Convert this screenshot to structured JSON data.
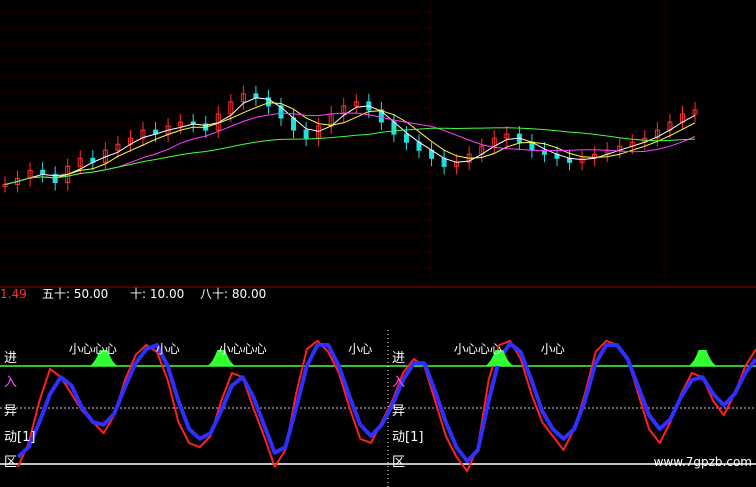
{
  "chart_data": [
    {
      "type": "candlestick",
      "title": "",
      "ylim": [
        0,
        100
      ],
      "grid": true,
      "series": [
        {
          "name": "",
          "color": "#ffffff",
          "values": [
            35,
            38,
            42,
            40,
            36,
            44,
            48,
            46,
            52,
            55,
            58,
            62,
            60,
            64,
            66,
            65,
            62,
            70,
            76,
            80,
            78,
            74,
            68,
            62,
            58,
            64,
            70,
            74,
            76,
            72,
            66,
            60,
            56,
            52,
            48,
            44,
            46,
            50,
            54,
            58,
            60,
            56,
            52,
            50,
            48,
            46,
            48,
            50,
            52,
            54,
            56,
            58,
            62,
            66,
            70,
            72
          ]
        }
      ]
    },
    {
      "type": "line",
      "title": "",
      "params": [
        {
          "label": "五十",
          "value": "50.00"
        },
        {
          "label": "十",
          "value": "10.00"
        },
        {
          "label": "八十",
          "value": "80.00"
        }
      ],
      "left_value": "1.49",
      "ylim": [
        0,
        100
      ],
      "series": [
        {
          "name": "",
          "color": "#ff2020",
          "values": [
            8,
            25,
            55,
            78,
            72,
            60,
            48,
            40,
            32,
            45,
            70,
            88,
            95,
            90,
            70,
            40,
            25,
            22,
            30,
            55,
            75,
            72,
            50,
            30,
            8,
            20,
            60,
            92,
            98,
            90,
            75,
            50,
            28,
            25,
            40,
            55,
            75,
            85,
            80,
            55,
            30,
            15,
            5,
            22,
            70,
            95,
            98,
            85,
            60,
            40,
            30,
            20,
            35,
            60,
            90,
            98,
            95,
            85,
            60,
            35,
            25,
            40,
            60,
            75,
            72,
            55,
            45,
            60,
            80,
            92
          ]
        },
        {
          "name": "",
          "color": "#2f2fff",
          "values": [
            15,
            22,
            40,
            60,
            72,
            66,
            50,
            40,
            38,
            46,
            65,
            82,
            92,
            95,
            80,
            55,
            35,
            28,
            32,
            48,
            66,
            72,
            58,
            38,
            18,
            22,
            50,
            80,
            95,
            95,
            80,
            58,
            38,
            30,
            38,
            52,
            70,
            82,
            82,
            62,
            40,
            22,
            12,
            20,
            55,
            85,
            96,
            90,
            70,
            48,
            35,
            28,
            35,
            55,
            82,
            95,
            95,
            85,
            65,
            45,
            35,
            42,
            58,
            70,
            72,
            60,
            52,
            60,
            75,
            85
          ]
        }
      ],
      "threshold_lines": [
        80,
        50,
        10
      ],
      "peak_markers_x": [
        8,
        19,
        45,
        64
      ],
      "annotations": [
        {
          "text": "小心心心",
          "x": 7
        },
        {
          "text": "小心",
          "x": 14
        },
        {
          "text": "小心心心",
          "x": 21
        },
        {
          "text": "小心",
          "x": 32
        },
        {
          "text": "小心心心",
          "x": 43
        },
        {
          "text": "小心",
          "x": 50
        }
      ],
      "side_labels": [
        {
          "text": "进",
          "color": "#ffffff"
        },
        {
          "text": "入",
          "color": "#ff55ff"
        },
        {
          "text": "异",
          "color": "#ffffff"
        },
        {
          "text": "动[1]",
          "color": "#ffffff"
        },
        {
          "text": "区",
          "color": "#ffffff"
        }
      ]
    }
  ],
  "watermark": "www.7gpzb.com"
}
